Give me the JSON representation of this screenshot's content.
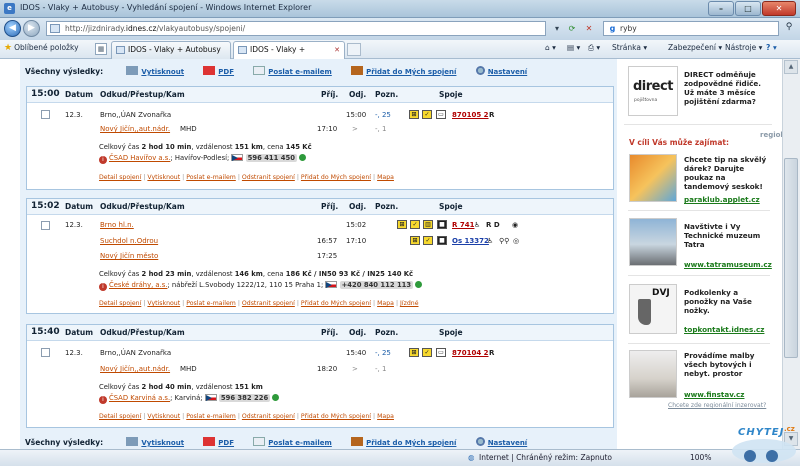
{
  "window": {
    "title": "IDOS - Vlaky + Autobusy - Vyhledání spojení - Windows Internet Explorer",
    "minimize": "–",
    "maximize": "□",
    "close": "✕"
  },
  "address": {
    "url_prefix": "http://jizdnirady.",
    "url_domain": "idnes.cz",
    "url_suffix": "/vlakyautobusy/spojeni/",
    "search_value": "ryby"
  },
  "favbar": {
    "favorites": "Oblíbené položky",
    "tab1": "IDOS - Vlaky + Autobusy ...",
    "tab2": "IDOS - Vlaky + Autobus...",
    "page_menu": "Stránka",
    "security_menu": "Zabezpečení",
    "tools_menu": "Nástroje",
    "help": "?"
  },
  "results_bar": {
    "label": "Všechny výsledky:",
    "print": "Vytisknout",
    "pdf": "PDF",
    "email": "Poslat e-mailem",
    "add": "Přidat do Mých spojení",
    "settings": "Nastavení"
  },
  "headers": {
    "date": "Datum",
    "route": "Odkud/Přestup/Kam",
    "arr": "Příj.",
    "dep": "Odj.",
    "note": "Pozn.",
    "conn": "Spoje"
  },
  "connections": [
    {
      "time": "15:00",
      "date": "12.3.",
      "from": "Brno,,ÚAN Zvonařka",
      "from_dep": "15:00",
      "from_note": "-, 25",
      "train": "870105 2",
      "train_extra": "R",
      "to": "Nový Jičín,,aut.nádr.",
      "to_extra": "MHD",
      "to_arr": "17:10",
      "to_dep": ">",
      "to_note": "-, 1",
      "summary_pre": "Celkový čas ",
      "summary_time": "2 hod 10 min",
      "summary_mid": ", vzdálenost ",
      "summary_dist": "151 km",
      "summary_price_pre": ", cena ",
      "summary_price": "145 Kč",
      "carrier": "ČSAD Havířov a.s.",
      "carrier_place": "; Havířov-Podlesí;",
      "phone": "596 411 450",
      "actions": [
        "Detail spojení",
        "Vytisknout",
        "Poslat e-mailem",
        "Odstranit spojení",
        "Přidat do Mých spojení",
        "Mapa"
      ]
    },
    {
      "time": "15:02",
      "date": "12.3.",
      "from": "Brno hl.n.",
      "from_dep": "15:02",
      "train": "R 741",
      "train_extra": "R D",
      "via": "Suchdol n.Odrou",
      "via_arr": "16:57",
      "via_dep": "17:10",
      "train2": "Os 13372",
      "to": "Nový Jičín město",
      "to_arr": "17:25",
      "summary_pre": "Celkový čas ",
      "summary_time": "2 hod 23 min",
      "summary_mid": ", vzdálenost ",
      "summary_dist": "146 km",
      "summary_price_pre": ", cena ",
      "summary_price": "186 Kč / IN50 93 Kč / IN25 140 Kč",
      "carrier": "České dráhy, a.s.",
      "carrier_place": "; nábřeží L.Svobody 1222/12, 110 15 Praha 1;",
      "phone": "+420 840 112 113",
      "actions": [
        "Detail spojení",
        "Vytisknout",
        "Poslat e-mailem",
        "Odstranit spojení",
        "Přidat do Mých spojení",
        "Mapa",
        "Jízdné"
      ]
    },
    {
      "time": "15:40",
      "date": "12.3.",
      "from": "Brno,,ÚAN Zvonařka",
      "from_dep": "15:40",
      "from_note": "-, 25",
      "train": "870104 2",
      "train_extra": "R",
      "to": "Nový Jičín,,aut.nádr.",
      "to_extra": "MHD",
      "to_arr": "18:20",
      "to_dep": ">",
      "to_note": "-, 1",
      "summary_pre": "Celkový čas ",
      "summary_time": "2 hod 40 min",
      "summary_mid": ", vzdálenost ",
      "summary_dist": "151 km",
      "carrier": "ČSAD Karviná a.s.",
      "carrier_place": "; Karviná;",
      "phone": "596 382 226",
      "actions": [
        "Detail spojení",
        "Vytisknout",
        "Poslat e-mailem",
        "Odstranit spojení",
        "Přidat do Mých spojení",
        "Mapa"
      ]
    }
  ],
  "sidebar": {
    "direct_logo": "direct",
    "direct_sub": "pojišťovna",
    "direct_text": "DIRECT odměňuje zodpovědné řidiče. Už máte 3 měsíce pojištění zdarma?",
    "promo_title": "V cíli Vás může zajímat:",
    "regiobox": "regiobox",
    "ads": [
      {
        "text": "Chcete tip na skvělý dárek? Darujte poukaz na tandemový seskok!",
        "link": "paraklub.applet.cz"
      },
      {
        "text": "Navštivte i Vy Technické muzeum Tatra",
        "link": "www.tatramuseum.cz"
      },
      {
        "text": "Podkolenky a ponožky na Vaše nožky.",
        "link": "topkontakt.idnes.cz",
        "img_label": "DVJ"
      },
      {
        "text": "Provádíme malby všech bytových i nebyt. prostor",
        "link": "www.finstav.cz"
      }
    ],
    "footer": "Chcete zde regionální inzerovat?"
  },
  "status": {
    "zone": "Internet | Chráněný režim: Zapnuto",
    "zoom": "100%"
  },
  "watermark": {
    "text": "CHYTEJ",
    "tld": ".cz"
  },
  "colors": {
    "accent_link": "#c04a00",
    "blue_link": "#1b5da8",
    "ad_link": "#1a7a1a",
    "promo_red": "#c0392b"
  }
}
